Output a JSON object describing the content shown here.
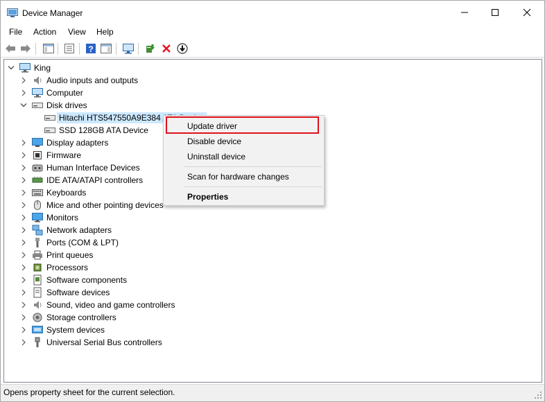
{
  "window": {
    "title": "Device Manager"
  },
  "menu": {
    "file": "File",
    "action": "Action",
    "view": "View",
    "help": "Help"
  },
  "tree": {
    "root": "King",
    "categories": [
      "Audio inputs and outputs",
      "Computer",
      "Disk drives",
      "Display adapters",
      "Firmware",
      "Human Interface Devices",
      "IDE ATA/ATAPI controllers",
      "Keyboards",
      "Mice and other pointing devices",
      "Monitors",
      "Network adapters",
      "Ports (COM & LPT)",
      "Print queues",
      "Processors",
      "Software components",
      "Software devices",
      "Sound, video and game controllers",
      "Storage controllers",
      "System devices",
      "Universal Serial Bus controllers"
    ],
    "disk_children": [
      "Hitachi HTS547550A9E384 ATA Device",
      "SSD 128GB ATA Device"
    ]
  },
  "context_menu": {
    "update": "Update driver",
    "disable": "Disable device",
    "uninstall": "Uninstall device",
    "scan": "Scan for hardware changes",
    "properties": "Properties"
  },
  "status": {
    "text": "Opens property sheet for the current selection."
  },
  "colors": {
    "selection": "#cce8ff",
    "highlight": "#e0101a",
    "delete_icon": "#e81123"
  }
}
